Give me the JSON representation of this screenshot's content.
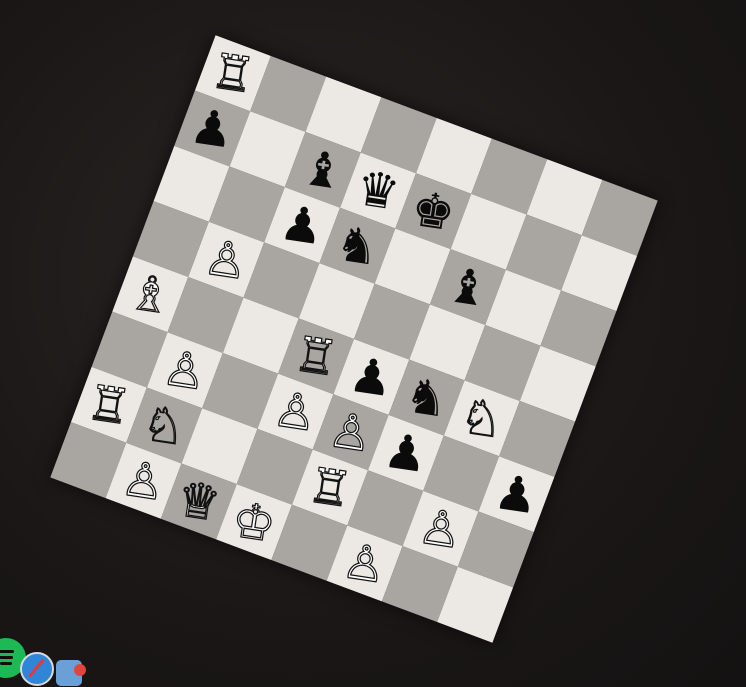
{
  "board": {
    "light_color": "#ece9e4",
    "dark_color": "#a9a6a2",
    "ranks": [
      [
        "wR",
        "",
        "",
        "",
        "",
        "",
        "",
        ""
      ],
      [
        "bP",
        "",
        "bB",
        "bQ",
        "bK",
        "",
        "",
        ""
      ],
      [
        "",
        "",
        "bP",
        "bN",
        "",
        "bB",
        "",
        ""
      ],
      [
        "",
        "wP",
        "",
        "",
        "",
        "",
        "",
        ""
      ],
      [
        "wB",
        "",
        "",
        "wR",
        "bP",
        "bN",
        "wN",
        ""
      ],
      [
        "",
        "wP",
        "",
        "wP",
        "wP",
        "bP",
        "",
        "bP"
      ],
      [
        "wR",
        "wN",
        "",
        "",
        "wR",
        "",
        "wP",
        ""
      ],
      [
        "",
        "wP",
        "wQ",
        "wK",
        "",
        "wP",
        "",
        ""
      ]
    ]
  },
  "pieces": {
    "wK": {
      "glyph": "♔",
      "name": "white-king"
    },
    "wQ": {
      "glyph": "♕",
      "name": "white-queen"
    },
    "wR": {
      "glyph": "♖",
      "name": "white-rook"
    },
    "wB": {
      "glyph": "♗",
      "name": "white-bishop"
    },
    "wN": {
      "glyph": "♘",
      "name": "white-knight"
    },
    "wP": {
      "glyph": "♙",
      "name": "white-pawn"
    },
    "bK": {
      "glyph": "♚",
      "name": "black-king"
    },
    "bQ": {
      "glyph": "♛",
      "name": "black-queen"
    },
    "bR": {
      "glyph": "♜",
      "name": "black-rook"
    },
    "bB": {
      "glyph": "♝",
      "name": "black-bishop"
    },
    "bN": {
      "glyph": "♞",
      "name": "black-knight"
    },
    "bP": {
      "glyph": "♟",
      "name": "black-pawn"
    }
  },
  "dock": {
    "icons": [
      "spotify-icon",
      "safari-icon",
      "app-icon"
    ]
  }
}
